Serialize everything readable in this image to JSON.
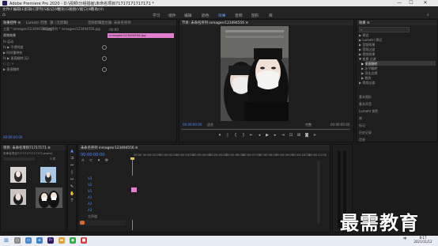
{
  "window": {
    "title": "Adobe Premiere Pro 2020 - D:\\视频\\分组插画\\未命名项目71717171717171 *",
    "minimize": "—",
    "maximize": "☐",
    "close": "✕"
  },
  "menu": [
    "文件(F)",
    "编辑(E)",
    "剪辑(C)",
    "序列(S)",
    "标记(M)",
    "图形(G)",
    "视图(V)",
    "窗口(W)",
    "帮助(H)"
  ],
  "workspaces": [
    "学习",
    "组件",
    "编辑",
    "颜色",
    "效果",
    "音频",
    "图形",
    "库"
  ],
  "workspace_active": "效果",
  "effect_controls": {
    "tabs": [
      "效果控件 ≡",
      "Lumetri 范围",
      "源: (无剪辑)",
      "音频剪辑混合器: 未命名序列"
    ],
    "source_label": "主要 * inmagesr123494556.jpg",
    "sequence_label": "未命名序列 * inmagesr123494556.jpg",
    "section_video": "视频效果",
    "rows": [
      "fx  运动",
      "fx  ▶ 不透明度",
      "     ▶ 时间重映射",
      "fx  ▶ 垂直翻转(无)",
      "     ○ □ ↗",
      "     ▶ 垂直翻转"
    ],
    "timecode": "00:00:00:00",
    "clip_name": "inmagesr123494556.jpg",
    "ruler_start": ":00:00"
  },
  "program": {
    "tab": "节目: 未命名序列 inmagesr123494556 ≡",
    "timecode_left": "00:00:00:00",
    "fit": "适合",
    "quality": "完整",
    "timecode_right": "00:00:05:00"
  },
  "effects_panel": {
    "title": "效果 ≡",
    "search_placeholder": "",
    "items": [
      "▶ 预设",
      "▶ Lumetri 预设",
      "▶ 音频效果",
      "▶ 音频过渡",
      "▶ 视频效果",
      "▼ 变换 过渡",
      "  ▶ 垂直翻转",
      "  ▶ 水平翻转",
      "  ▶ 羽化边缘",
      "  ▶ 裁剪",
      "▶ 视频过渡"
    ],
    "sections": [
      "基本图形",
      "基本声音",
      "Lumetri 颜色",
      "库",
      "标记",
      "历史记录",
      "信息"
    ]
  },
  "project": {
    "tab": "项目: 未命名项目71717171 ≡",
    "path": "未命名项目71717171717171.prproj",
    "count": "5 项"
  },
  "timeline": {
    "tab": "未命名序列 inmagesr123494556 ≡",
    "timecode": "00:00:00:00",
    "ruler": [
      "00:00",
      "00:00:01:00",
      "00:00:02:00",
      "00:00:03:00",
      "00:00:04:00",
      "00:00:05:00",
      "00:00:06:00",
      "00:00:07:00",
      "00:00:08:00",
      "00:00:09:00",
      "00:00:10:00",
      "00:00:11:00"
    ],
    "tracks": [
      "V3",
      "V2",
      "V1",
      "A1",
      "A2",
      "A3",
      "主声道"
    ]
  },
  "taskbar": {
    "time": "8:17",
    "date": "2021/11/12",
    "lang": "中"
  },
  "watermark": "最需教育"
}
